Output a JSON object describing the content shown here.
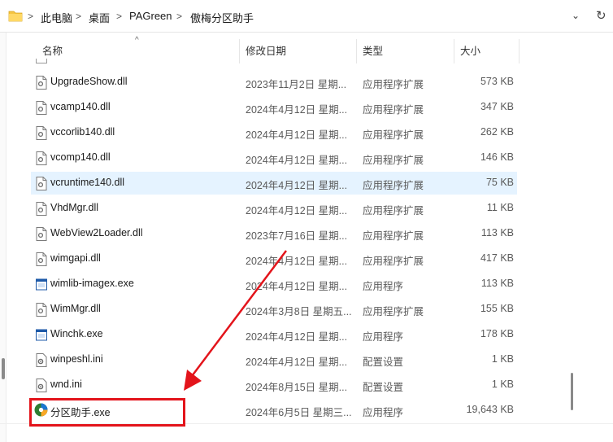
{
  "address_bar": {
    "crumbs": [
      "此电脑",
      "桌面",
      "PAGreen",
      "傲梅分区助手"
    ],
    "separator": ">",
    "dropdown_icon": "chevron-down-icon",
    "refresh_icon": "refresh-icon",
    "dropdown_glyph": "⌄",
    "refresh_glyph": "↻"
  },
  "columns": {
    "name": "名称",
    "modified": "修改日期",
    "type": "类型",
    "size": "大小",
    "sort_glyph": "^"
  },
  "files": [
    {
      "name": "UpgradeShow.dll",
      "date": "2023年11月2日 星期...",
      "type": "应用程序扩展",
      "size": "573 KB",
      "icon": "dll-file-icon"
    },
    {
      "name": "vcamp140.dll",
      "date": "2024年4月12日 星期...",
      "type": "应用程序扩展",
      "size": "347 KB",
      "icon": "dll-file-icon"
    },
    {
      "name": "vccorlib140.dll",
      "date": "2024年4月12日 星期...",
      "type": "应用程序扩展",
      "size": "262 KB",
      "icon": "dll-file-icon"
    },
    {
      "name": "vcomp140.dll",
      "date": "2024年4月12日 星期...",
      "type": "应用程序扩展",
      "size": "146 KB",
      "icon": "dll-file-icon"
    },
    {
      "name": "vcruntime140.dll",
      "date": "2024年4月12日 星期...",
      "type": "应用程序扩展",
      "size": "75 KB",
      "icon": "dll-file-icon",
      "selected": true
    },
    {
      "name": "VhdMgr.dll",
      "date": "2024年4月12日 星期...",
      "type": "应用程序扩展",
      "size": "11 KB",
      "icon": "dll-file-icon"
    },
    {
      "name": "WebView2Loader.dll",
      "date": "2023年7月16日 星期...",
      "type": "应用程序扩展",
      "size": "113 KB",
      "icon": "dll-file-icon"
    },
    {
      "name": "wimgapi.dll",
      "date": "2024年4月12日 星期...",
      "type": "应用程序扩展",
      "size": "417 KB",
      "icon": "dll-file-icon"
    },
    {
      "name": "wimlib-imagex.exe",
      "date": "2024年4月12日 星期...",
      "type": "应用程序",
      "size": "113 KB",
      "icon": "exe-file-icon"
    },
    {
      "name": "WimMgr.dll",
      "date": "2024年3月8日 星期五...",
      "type": "应用程序扩展",
      "size": "155 KB",
      "icon": "dll-file-icon"
    },
    {
      "name": "Winchk.exe",
      "date": "2024年4月12日 星期...",
      "type": "应用程序",
      "size": "178 KB",
      "icon": "exe-file-icon"
    },
    {
      "name": "winpeshl.ini",
      "date": "2024年4月12日 星期...",
      "type": "配置设置",
      "size": "1 KB",
      "icon": "ini-file-icon"
    },
    {
      "name": "wnd.ini",
      "date": "2024年8月15日 星期...",
      "type": "配置设置",
      "size": "1 KB",
      "icon": "ini-file-icon"
    },
    {
      "name": "分区助手.exe",
      "date": "2024年6月5日 星期三...",
      "type": "应用程序",
      "size": "19,643 KB",
      "icon": "partition-assistant-app-icon"
    }
  ],
  "colors": {
    "selection": "#e5f3ff",
    "annotation_red": "#e3141b",
    "folder_yellow": "#f5c542",
    "exe_blue": "#1e5aa8"
  }
}
